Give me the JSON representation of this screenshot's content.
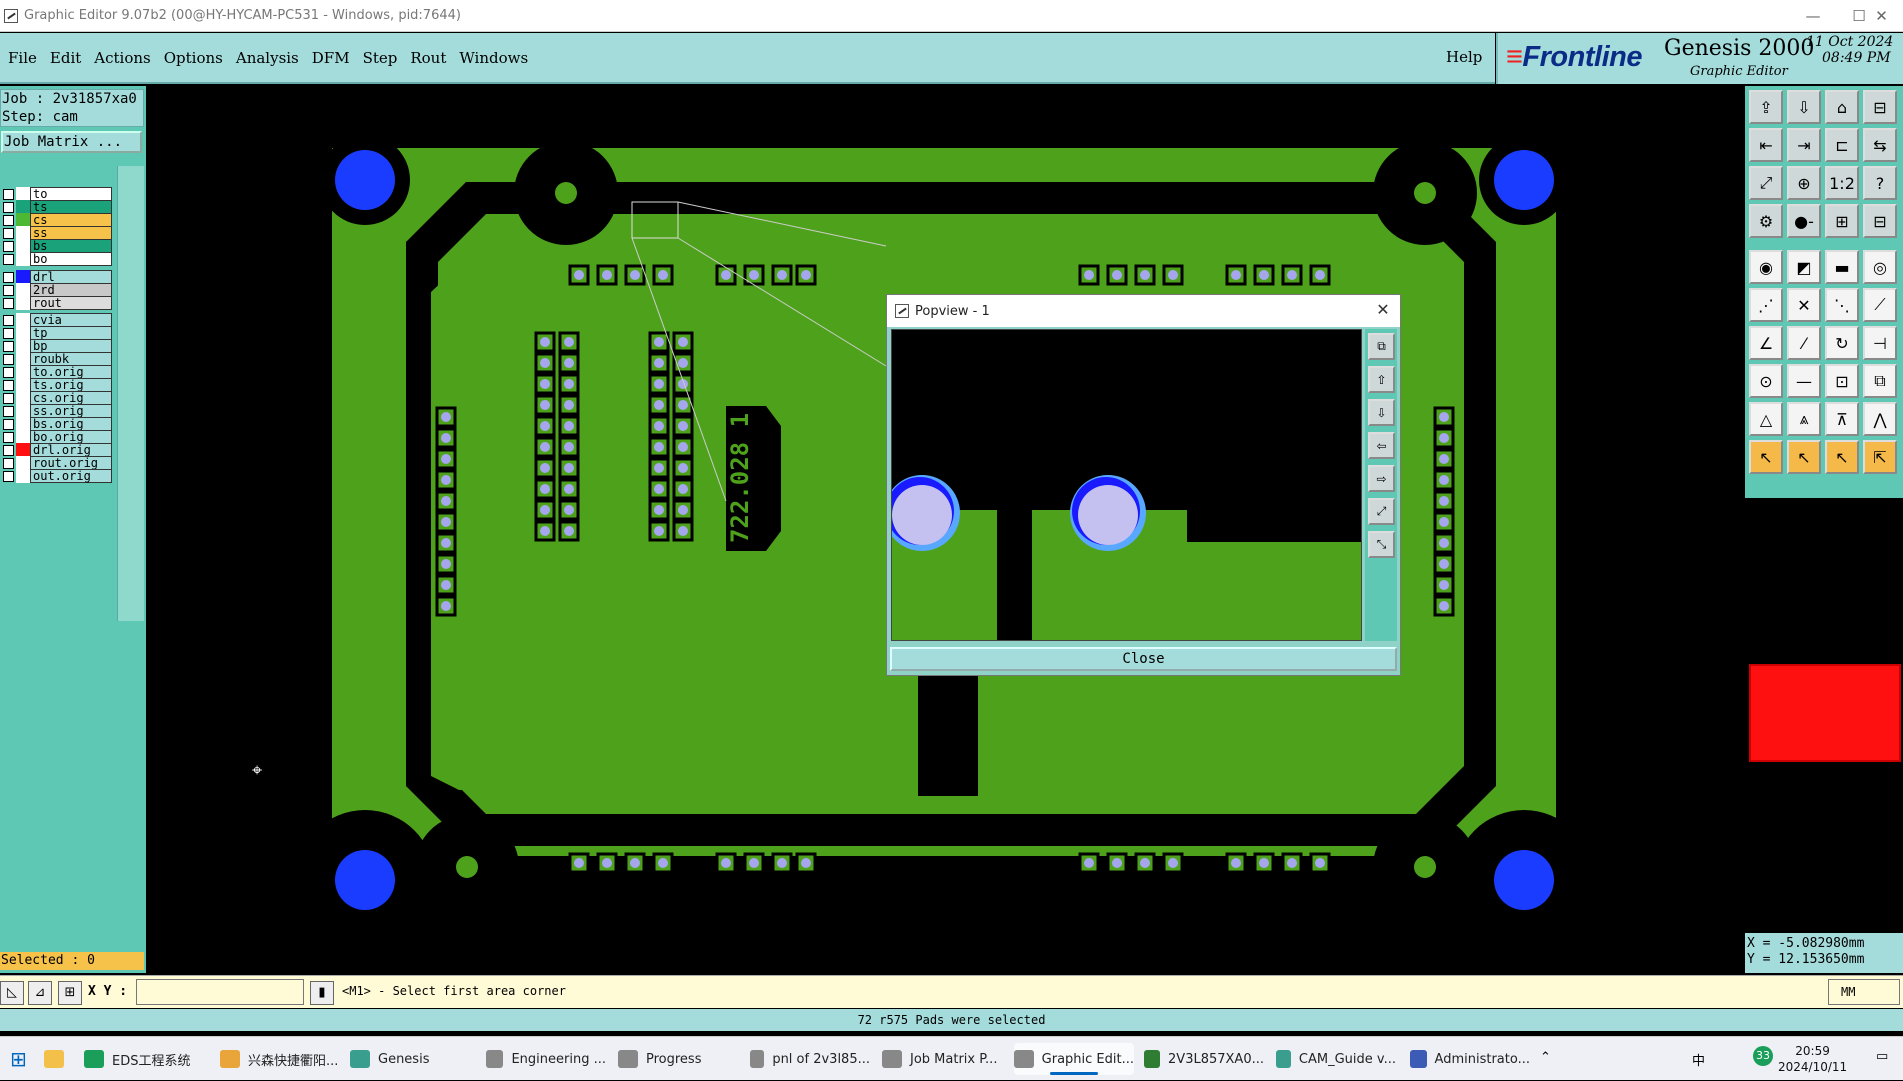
{
  "window": {
    "title": "Graphic Editor 9.07b2 (00@HY-HYCAM-PC531 - Windows, pid:7644)",
    "controls": {
      "minimize": "—",
      "maximize": "☐",
      "close": "✕"
    }
  },
  "menu": {
    "items": [
      "File",
      "Edit",
      "Actions",
      "Options",
      "Analysis",
      "DFM",
      "Step",
      "Rout",
      "Windows"
    ],
    "help": "Help"
  },
  "brand": {
    "logo": "Frontline",
    "product": "Genesis 2000",
    "subtitle": "Graphic Editor",
    "date": "11 Oct 2024",
    "time": "08:49 PM"
  },
  "job": {
    "job_line": "Job : 2v31857xa0",
    "step_line": "Step: cam",
    "matrix_button": "Job Matrix ..."
  },
  "layers": [
    {
      "name": "to",
      "color": "#ffffff",
      "fill": "#ffffff"
    },
    {
      "name": "ts",
      "color": "#1aa37a",
      "fill": "#1aa37a"
    },
    {
      "name": "cs",
      "color": "#4cb833",
      "fill": "#f6c24a"
    },
    {
      "name": "ss",
      "color": "#ffffff",
      "fill": "#f6c24a"
    },
    {
      "name": "bs",
      "color": "#ffffff",
      "fill": "#1aa37a"
    },
    {
      "name": "bo",
      "color": "#ffffff",
      "fill": "#ffffff"
    },
    {
      "name": "drl",
      "color": "#1a1aff",
      "fill": "#a4dcdc"
    },
    {
      "name": "2rd",
      "color": "#ffffff",
      "fill": "#c8c8c8"
    },
    {
      "name": "rout",
      "color": "#ffffff",
      "fill": "#dcdcdc"
    },
    {
      "name": "cvia",
      "color": "#ffffff",
      "fill": "#a4dcdc"
    },
    {
      "name": "tp",
      "color": "#ffffff",
      "fill": "#a4dcdc"
    },
    {
      "name": "bp",
      "color": "#ffffff",
      "fill": "#a4dcdc"
    },
    {
      "name": "roubk",
      "color": "#ffffff",
      "fill": "#a4dcdc"
    },
    {
      "name": "to.orig",
      "color": "#ffffff",
      "fill": "#a4dcdc"
    },
    {
      "name": "ts.orig",
      "color": "#ffffff",
      "fill": "#a4dcdc"
    },
    {
      "name": "cs.orig",
      "color": "#ffffff",
      "fill": "#a4dcdc"
    },
    {
      "name": "ss.orig",
      "color": "#ffffff",
      "fill": "#a4dcdc"
    },
    {
      "name": "bs.orig",
      "color": "#ffffff",
      "fill": "#a4dcdc"
    },
    {
      "name": "bo.orig",
      "color": "#ffffff",
      "fill": "#a4dcdc"
    },
    {
      "name": "drl.orig",
      "color": "#ff1010",
      "fill": "#a4dcdc"
    },
    {
      "name": "rout.orig",
      "color": "#ffffff",
      "fill": "#a4dcdc"
    },
    {
      "name": "out.orig",
      "color": "#ffffff",
      "fill": "#a4dcdc"
    }
  ],
  "selected": "Selected : 0",
  "board": {
    "silkscreen_text": "722.028 1",
    "copper_color": "#4ea21b",
    "pad_color": "#a6a6ee",
    "tooling_hole_color": "#1a3cff"
  },
  "popview": {
    "title": "Popview - 1",
    "close_button": "Close"
  },
  "coords": {
    "x": "X = -5.082980mm",
    "y": "Y = 12.153650mm"
  },
  "command": {
    "xy_label": "X Y :",
    "xy_value": "",
    "prompt": "<M1> - Select first area corner",
    "units": "MM"
  },
  "status": "72 r575 Pads were selected",
  "taskbar": {
    "items": [
      {
        "label": "EDS工程系统",
        "color": "#1a9e5a"
      },
      {
        "label": "兴森快捷衢阳...",
        "color": "#e9a43a"
      },
      {
        "label": "Genesis",
        "color": "#3a9e8e"
      },
      {
        "label": "Engineering ...",
        "color": "#888888"
      },
      {
        "label": "Progress",
        "color": "#888888"
      },
      {
        "label": "pnl of 2v3l85...",
        "color": "#888888"
      },
      {
        "label": "Job Matrix P...",
        "color": "#888888"
      },
      {
        "label": "Graphic Edit...",
        "color": "#888888"
      },
      {
        "label": "2V3L857XA0...",
        "color": "#2e7d32"
      },
      {
        "label": "CAM_Guide v...",
        "color": "#3a9e8e"
      },
      {
        "label": "Administrato...",
        "color": "#3b5bb5"
      }
    ],
    "tray": {
      "ime": "中",
      "notifications": "33",
      "time": "20:59",
      "date": "2024/10/11"
    }
  }
}
